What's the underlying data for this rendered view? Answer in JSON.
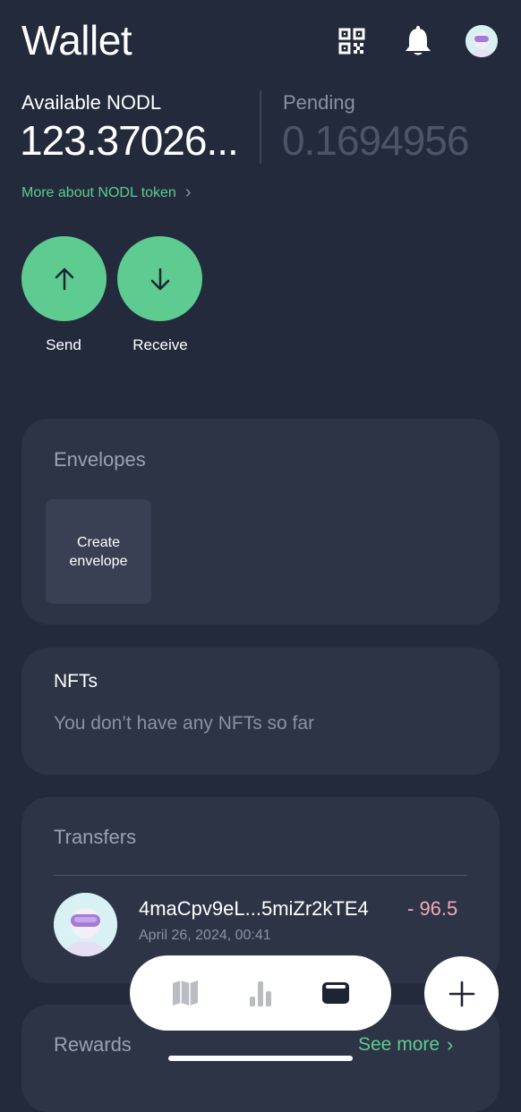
{
  "header": {
    "title": "Wallet",
    "icons": [
      "qr-code-icon",
      "bell-icon",
      "avatar"
    ]
  },
  "balance": {
    "available_label": "Available NODL",
    "available_value": "123.37026...",
    "pending_label": "Pending",
    "pending_value": "0.1694956",
    "more_link": "More about NODL token"
  },
  "actions": {
    "send_label": "Send",
    "receive_label": "Receive"
  },
  "envelopes": {
    "title": "Envelopes",
    "create_label_line1": "Create",
    "create_label_line2": "envelope"
  },
  "nfts": {
    "title": "NFTs",
    "empty_text": "You don’t have any NFTs so far"
  },
  "transfers": {
    "title": "Transfers",
    "items": [
      {
        "address": "4maCpv9eL...5miZr2kTE4",
        "amount": "- 96.5",
        "date": "April 26, 2024, 00:41"
      }
    ]
  },
  "rewards": {
    "title": "Rewards",
    "see_more": "See more"
  },
  "bottom_nav": {
    "items": [
      "map-icon",
      "stats-icon",
      "wallet-icon"
    ],
    "active": "wallet-icon",
    "fab": "plus-icon"
  },
  "colors": {
    "background": "#232a3b",
    "card": "#2d3446",
    "accent": "#5ecb90",
    "negative_amount": "#f2a9b3"
  }
}
